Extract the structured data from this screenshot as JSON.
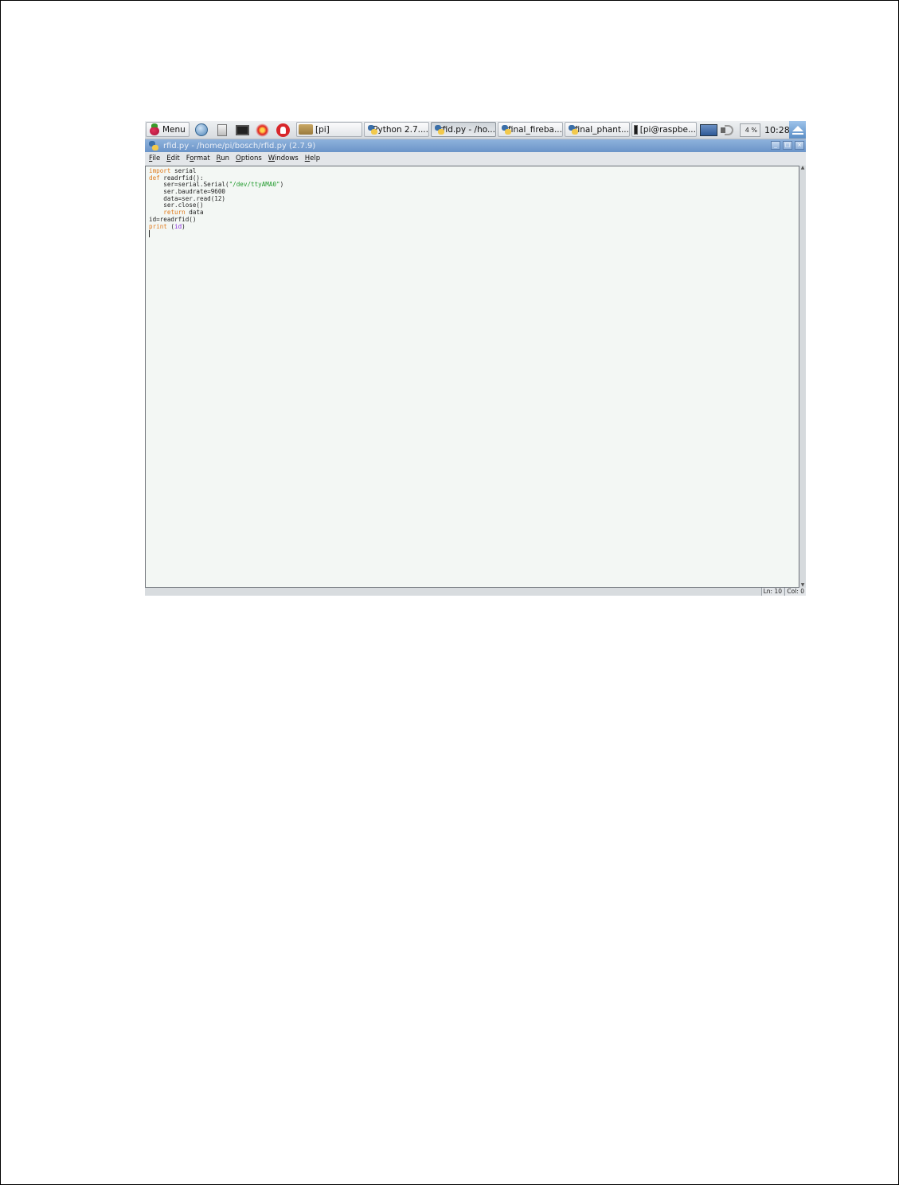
{
  "taskbar": {
    "menu_label": "Menu",
    "folder_task": "[pi]",
    "tasks": [
      {
        "label": "Python 2.7...."
      },
      {
        "label": "rfid.py - /ho..."
      },
      {
        "label": "final_fireba..."
      },
      {
        "label": "final_phant..."
      }
    ],
    "terminal_task": "[pi@raspbe...",
    "cpu_usage": "4 %",
    "clock": "10:28"
  },
  "window": {
    "title": "rfid.py - /home/pi/bosch/rfid.py (2.7.9)",
    "controls": {
      "minimize": "_",
      "maximize": "□",
      "close": "×"
    }
  },
  "menubar": {
    "items": [
      {
        "mnemonic": "F",
        "rest": "ile"
      },
      {
        "mnemonic": "E",
        "rest": "dit"
      },
      {
        "pre": "F",
        "mnemonic": "o",
        "rest": "rmat"
      },
      {
        "mnemonic": "R",
        "rest": "un"
      },
      {
        "mnemonic": "O",
        "rest": "ptions"
      },
      {
        "mnemonic": "W",
        "rest": "indows"
      },
      {
        "mnemonic": "H",
        "rest": "elp"
      }
    ]
  },
  "editor": {
    "lines": [
      [
        {
          "t": "import",
          "c": "kw"
        },
        {
          "t": " serial",
          "c": ""
        }
      ],
      [
        {
          "t": "def",
          "c": "kw"
        },
        {
          "t": " readrfid():",
          "c": ""
        }
      ],
      [
        {
          "t": "    ser=serial.Serial(",
          "c": ""
        },
        {
          "t": "\"/dev/ttyAMA0\"",
          "c": "str"
        },
        {
          "t": ")",
          "c": ""
        }
      ],
      [
        {
          "t": "    ser.baudrate=9600",
          "c": ""
        }
      ],
      [
        {
          "t": "    data=ser.read(12)",
          "c": ""
        }
      ],
      [
        {
          "t": "    ser.close()",
          "c": ""
        }
      ],
      [
        {
          "t": "    ",
          "c": ""
        },
        {
          "t": "return",
          "c": "kw"
        },
        {
          "t": " data",
          "c": ""
        }
      ],
      [
        {
          "t": "id=readrfid()",
          "c": ""
        }
      ],
      [
        {
          "t": "print",
          "c": "kw"
        },
        {
          "t": " (",
          "c": ""
        },
        {
          "t": "id",
          "c": "builtin"
        },
        {
          "t": ")",
          "c": ""
        }
      ]
    ]
  },
  "statusbar": {
    "line": "Ln: 10",
    "col": "Col: 0"
  },
  "colors": {
    "keyword": "#e07b1d",
    "string": "#1f9a2b",
    "builtin": "#8a2be2",
    "titlebar": "#7aa2d2",
    "editor_bg": "#f3f7f4"
  }
}
